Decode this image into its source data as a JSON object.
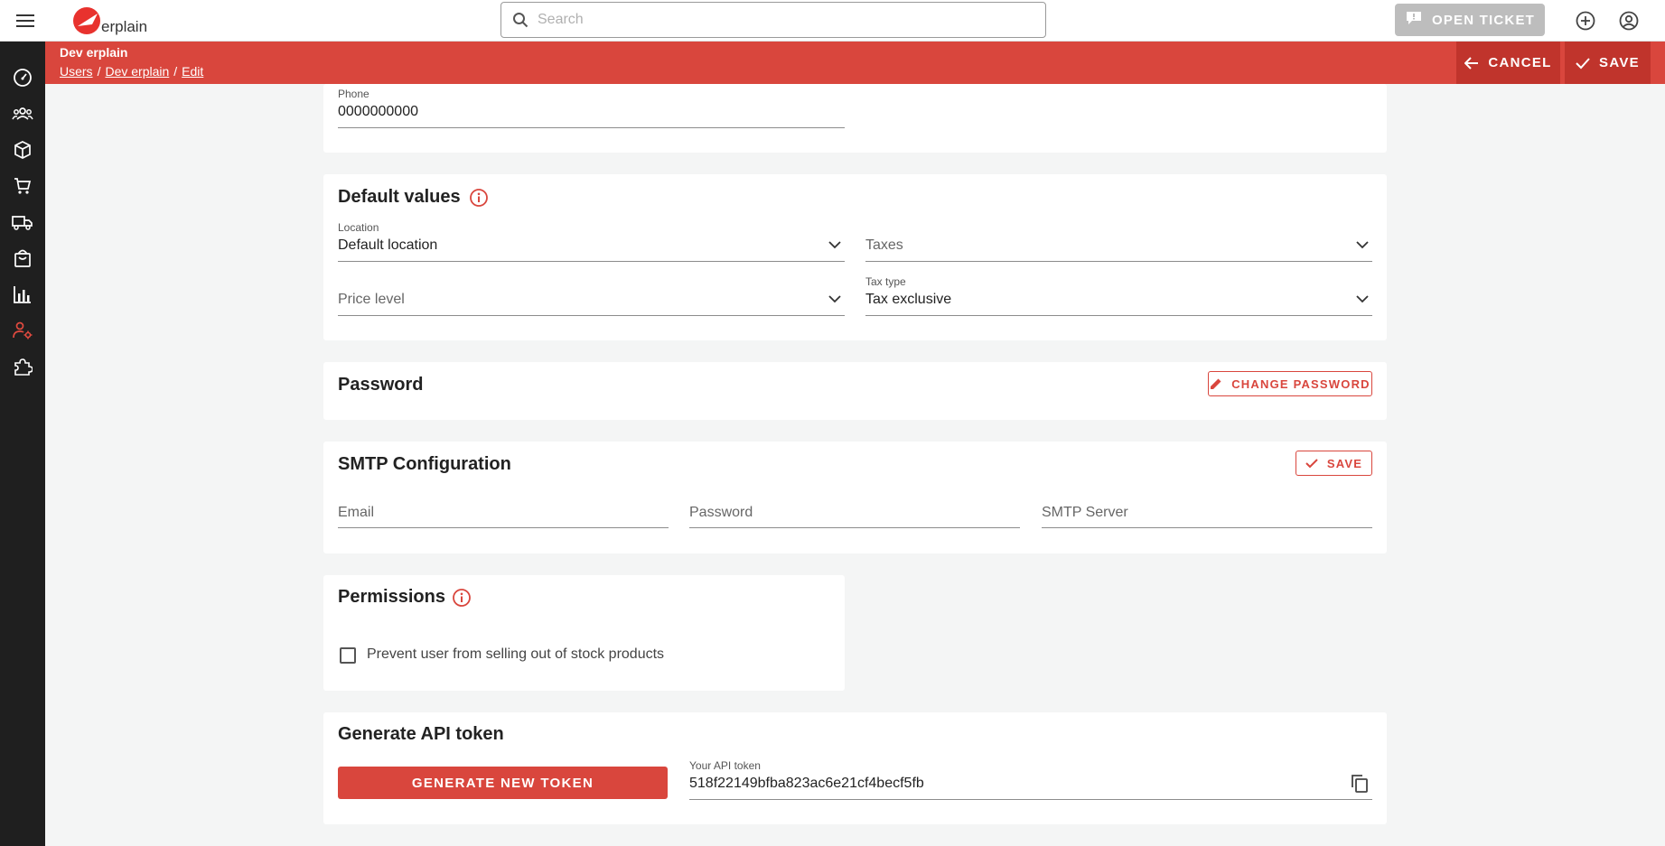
{
  "app": {
    "logo_text": "erplain",
    "brand_color": "#d9463d",
    "sidebar_color": "#1f1f1f"
  },
  "topbar": {
    "menu_icon": "hamburger-icon",
    "search_placeholder": "Search",
    "open_ticket_label": "OPEN TICKET",
    "icons": [
      "add-circle-icon",
      "account-circle-icon"
    ]
  },
  "sidebar": {
    "items": [
      {
        "name": "dashboard",
        "icon": "speedometer-icon",
        "active": false
      },
      {
        "name": "contacts",
        "icon": "people-icon",
        "active": false
      },
      {
        "name": "products",
        "icon": "cube-icon",
        "active": false
      },
      {
        "name": "sales",
        "icon": "cart-icon",
        "active": false
      },
      {
        "name": "shipping",
        "icon": "truck-icon",
        "active": false
      },
      {
        "name": "purchases",
        "icon": "shopping-bag-icon",
        "active": false
      },
      {
        "name": "reports",
        "icon": "bar-chart-icon",
        "active": false
      },
      {
        "name": "user-settings",
        "icon": "user-gear-icon",
        "active": true
      },
      {
        "name": "integrations",
        "icon": "puzzle-icon",
        "active": false
      }
    ]
  },
  "header": {
    "title": "Dev erplain",
    "breadcrumb": [
      "Users",
      "Dev erplain",
      "Edit"
    ],
    "cancel_label": "CANCEL",
    "save_label": "SAVE"
  },
  "contact": {
    "phone_label": "Phone",
    "phone_value": "0000000000"
  },
  "defaults": {
    "title": "Default values",
    "location_label": "Location",
    "location_value": "Default location",
    "taxes_placeholder": "Taxes",
    "price_level_placeholder": "Price level",
    "tax_type_label": "Tax type",
    "tax_type_value": "Tax exclusive"
  },
  "password": {
    "title": "Password",
    "change_label": "CHANGE PASSWORD"
  },
  "smtp": {
    "title": "SMTP Configuration",
    "save_label": "SAVE",
    "email_placeholder": "Email",
    "password_placeholder": "Password",
    "server_placeholder": "SMTP Server"
  },
  "permissions": {
    "title": "Permissions",
    "prevent_label": "Prevent user from selling out of stock products",
    "prevent_checked": false
  },
  "api": {
    "title": "Generate API token",
    "generate_label": "GENERATE NEW TOKEN",
    "token_label": "Your API token",
    "token_value": "518f22149bfba823ac6e21cf4becf5fb"
  }
}
